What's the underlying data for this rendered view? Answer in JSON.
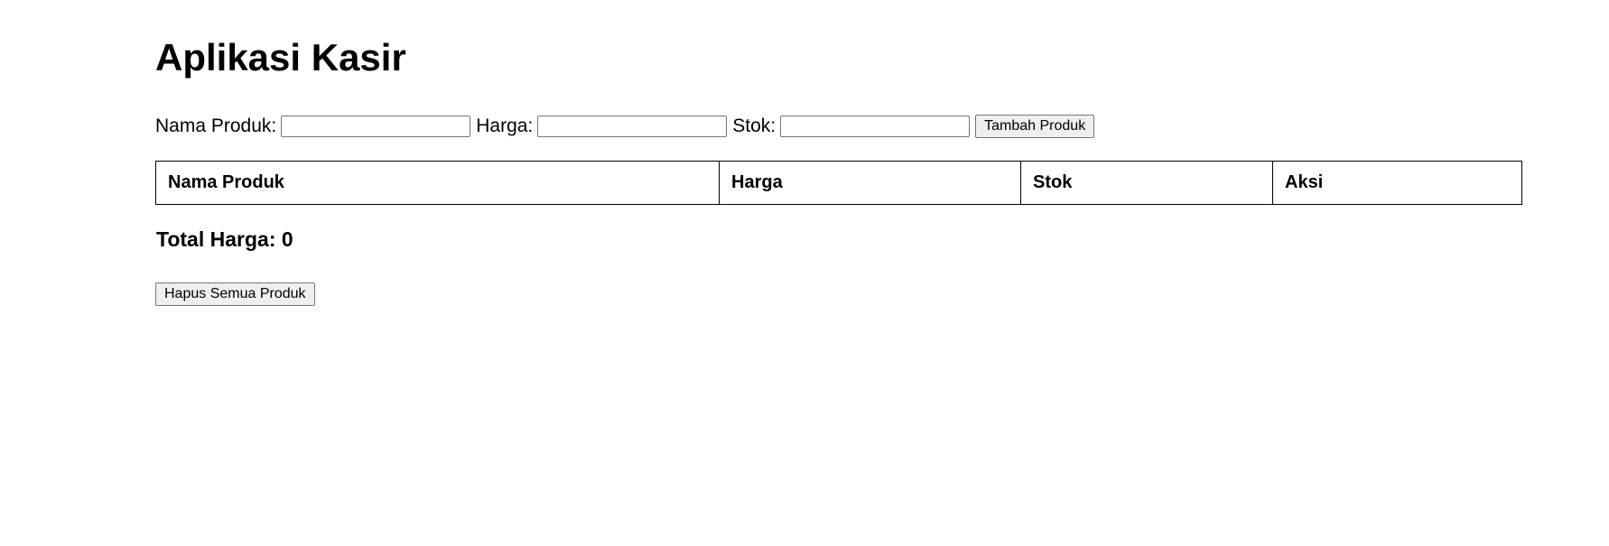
{
  "app": {
    "title": "Aplikasi Kasir"
  },
  "form": {
    "product_name_label": "Nama Produk:",
    "product_name_value": "",
    "price_label": "Harga:",
    "price_value": "",
    "stock_label": "Stok:",
    "stock_value": "",
    "add_button_label": "Tambah Produk"
  },
  "table": {
    "columns": [
      "Nama Produk",
      "Harga",
      "Stok",
      "Aksi"
    ],
    "rows": []
  },
  "summary": {
    "total_label": "Total Harga: 0"
  },
  "actions": {
    "clear_all_label": "Hapus Semua Produk"
  },
  "colors": {
    "background": "#ffffff",
    "text": "#000000",
    "button_bg": "#efefef",
    "input_border": "#767676",
    "table_border": "#000000"
  }
}
